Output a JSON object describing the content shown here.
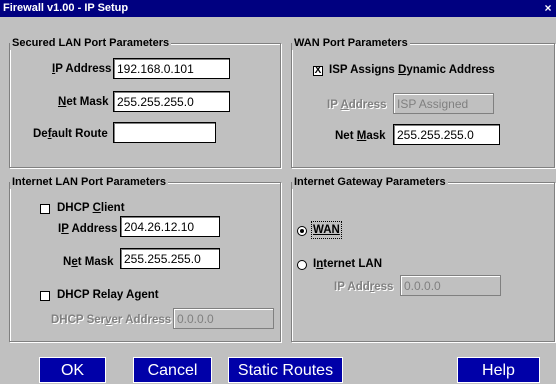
{
  "window": {
    "title": "Firewall v1.00 - IP Setup",
    "close_label": "×"
  },
  "secured_lan": {
    "title": "Secured LAN Port Parameters",
    "ip_label_pre": "",
    "ip_label_u": "I",
    "ip_label_post": "P Address",
    "ip_value": "192.168.0.101",
    "mask_label_pre": "",
    "mask_label_u": "N",
    "mask_label_post": "et Mask",
    "mask_value": "255.255.255.0",
    "route_label_pre": "De",
    "route_label_u": "f",
    "route_label_post": "ault Route",
    "route_value": ""
  },
  "wan": {
    "title": "WAN Port Parameters",
    "isp_pre": "ISP Assigns ",
    "isp_u": "D",
    "isp_post": "ynamic Address",
    "isp_checked": true,
    "check_mark": "X",
    "ip_label_pre": "IP ",
    "ip_label_u": "A",
    "ip_label_post": "ddress",
    "ip_value": "ISP Assigned",
    "mask_label_pre": "Net ",
    "mask_label_u": "M",
    "mask_label_post": "ask",
    "mask_value": "255.255.255.0"
  },
  "internet_lan": {
    "title": "Internet LAN Port Parameters",
    "dhcp_pre": "DHCP ",
    "dhcp_u": "C",
    "dhcp_post": "lient",
    "dhcp_checked": false,
    "ip_label_pre": "I",
    "ip_label_u": "P",
    "ip_label_post": " Address",
    "ip_value": "204.26.12.10",
    "mask_label_pre": "N",
    "mask_label_u": "e",
    "mask_label_post": "t Mask",
    "mask_value": "255.255.255.0",
    "relay_label": "DHCP Relay Agent",
    "relay_checked": false,
    "server_label_pre": "DHCP Ser",
    "server_label_u": "v",
    "server_label_post": "er Address",
    "server_value": "0.0.0.0"
  },
  "gateway": {
    "title": "Internet Gateway Parameters",
    "wan_label": "WAN",
    "wan_selected": true,
    "inet_pre": "I",
    "inet_u": "n",
    "inet_post": "ternet LAN",
    "inet_selected": false,
    "ip_label_pre": "IP Add",
    "ip_label_u": "r",
    "ip_label_post": "ess",
    "ip_value": "0.0.0.0"
  },
  "buttons": {
    "ok": "OK",
    "cancel": "Cancel",
    "static_routes": "Static Routes",
    "help": "Help"
  }
}
